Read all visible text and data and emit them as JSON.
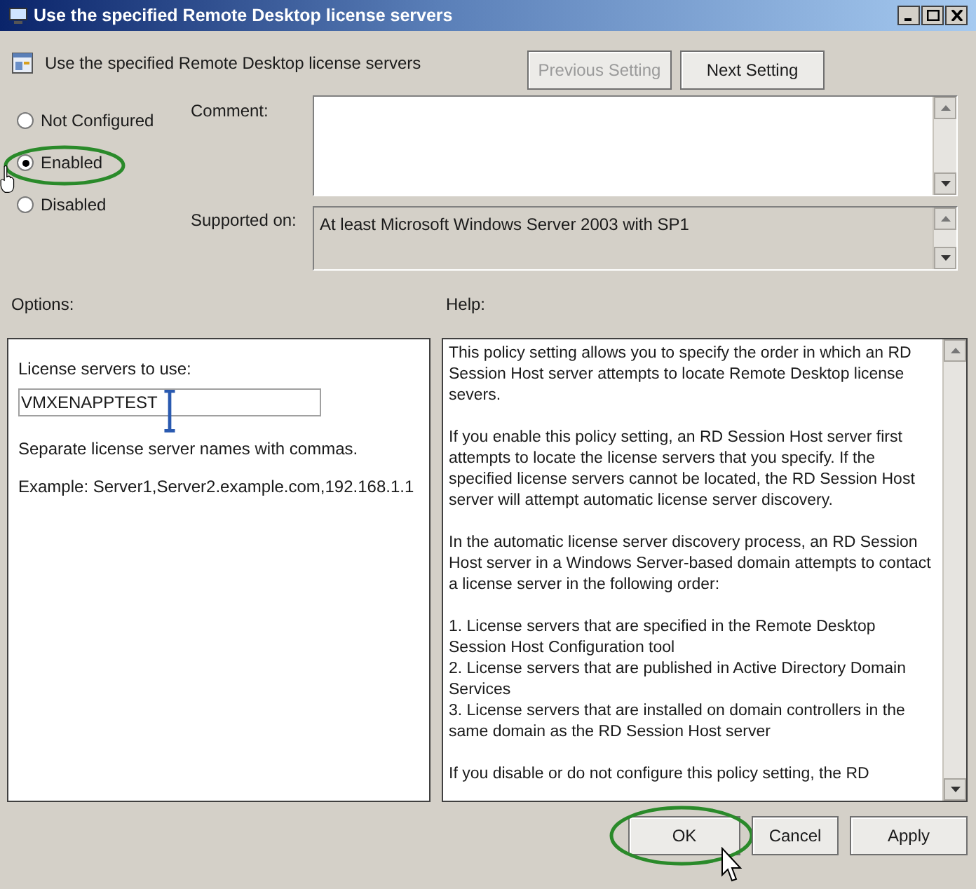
{
  "window": {
    "title": "Use the specified Remote Desktop license servers"
  },
  "header": {
    "title": "Use the specified Remote Desktop license servers"
  },
  "nav_buttons": [
    {
      "label": "Previous Setting",
      "disabled": true
    },
    {
      "label": "Next Setting",
      "disabled": false
    }
  ],
  "state_options": [
    {
      "label": "Not Configured",
      "selected": false
    },
    {
      "label": "Enabled",
      "selected": true
    },
    {
      "label": "Disabled",
      "selected": false
    }
  ],
  "comment": {
    "label": "Comment:"
  },
  "supported_on": {
    "label": "Supported on:",
    "value": "At least Microsoft Windows Server 2003 with SP1"
  },
  "options": {
    "label": "Options:",
    "field_label": "License servers to use:",
    "value": "VMXENAPPTEST",
    "notes": [
      "Separate license server names with commas.",
      "Example: Server1,Server2.example.com,192.168.1.1"
    ]
  },
  "help": {
    "label": "Help:",
    "paragraphs": [
      "This policy setting allows you to specify the order in which an RD Session Host server attempts to locate Remote Desktop license severs.",
      "If you enable this policy setting, an RD Session Host server first attempts to locate the license servers that you specify. If the specified license servers cannot be located, the RD Session Host server will attempt automatic license server discovery.",
      "In the automatic license server discovery process, an RD Session Host server in a Windows Server-based domain attempts to contact a license server in the following order:",
      "1. License servers that are specified in the Remote Desktop Session Host Configuration tool\n2. License servers that are published in Active Directory Domain Services\n3. License servers that are installed on domain controllers in the same domain as the RD Session Host server",
      "If you disable or do not configure this policy setting, the RD"
    ]
  },
  "footer_buttons": [
    {
      "label": "OK",
      "highlighted": true
    },
    {
      "label": "Cancel",
      "highlighted": false
    },
    {
      "label": "Apply",
      "highlighted": false
    }
  ]
}
